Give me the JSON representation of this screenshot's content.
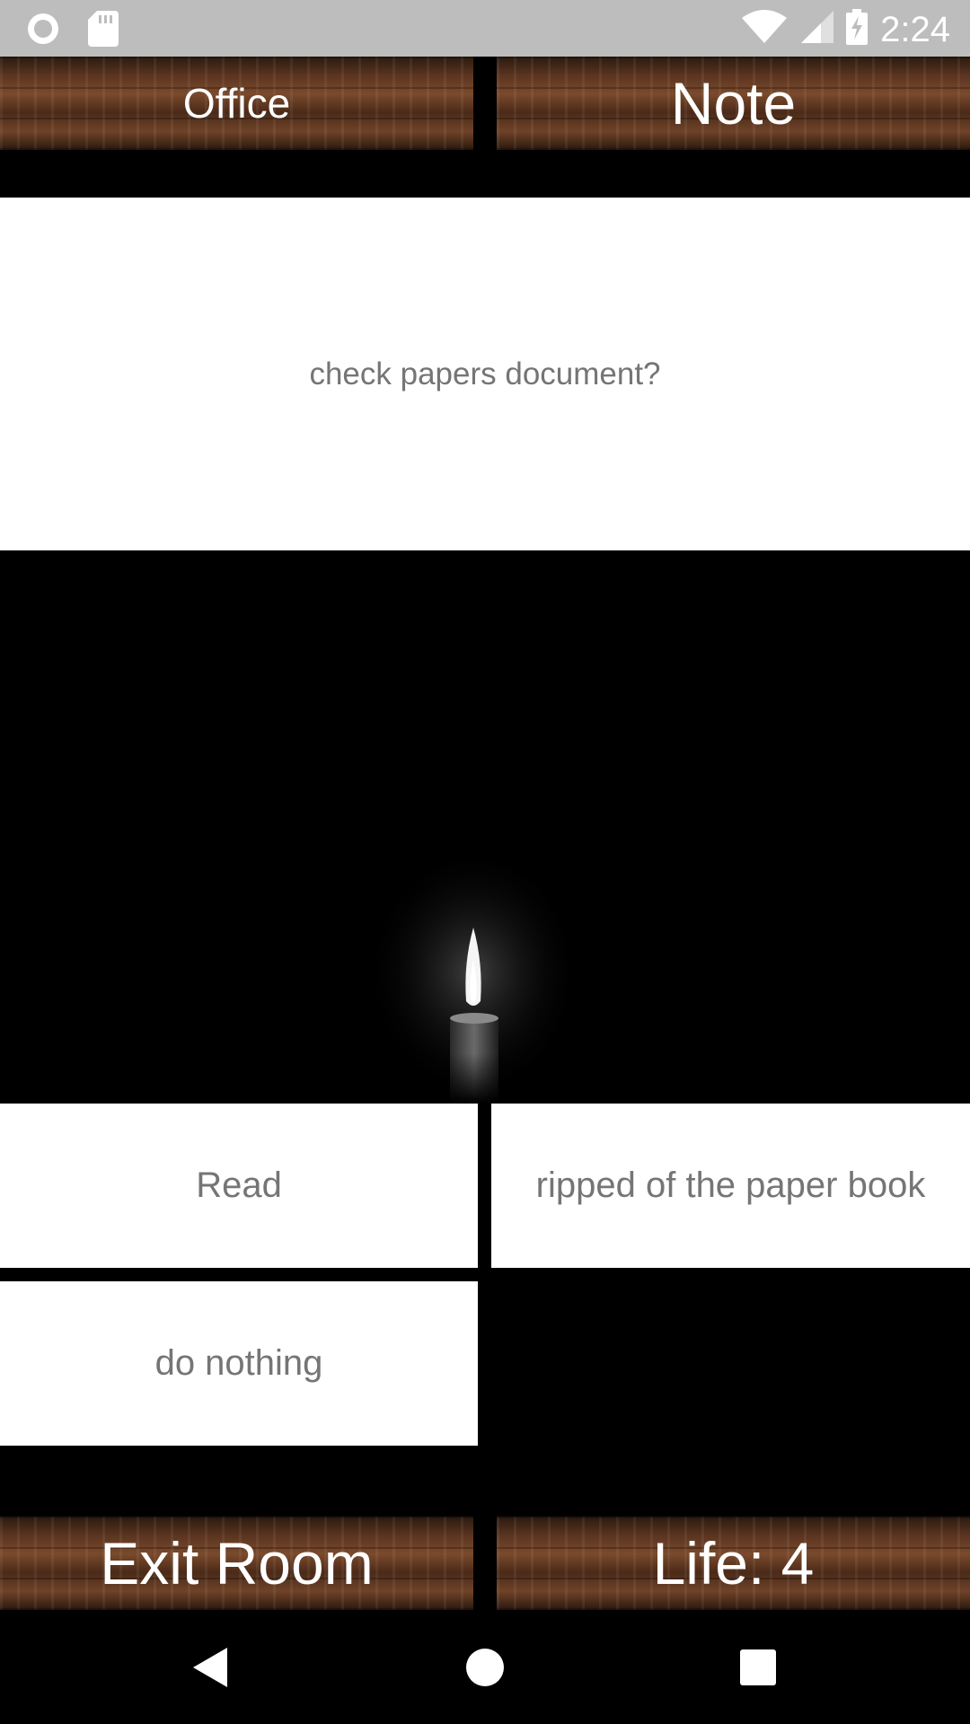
{
  "status_bar": {
    "time": "2:24",
    "icons": [
      "circle-record-icon",
      "sd-card-icon",
      "wifi-icon",
      "signal-icon",
      "battery-charging-icon"
    ]
  },
  "header": {
    "room_label": "Office",
    "note_label": "Note"
  },
  "question": {
    "text": "check papers document?"
  },
  "scene": {
    "image": "candle-icon"
  },
  "choices": [
    {
      "label": "Read"
    },
    {
      "label": "ripped of the paper book"
    },
    {
      "label": "do nothing"
    }
  ],
  "footer": {
    "exit_label": "Exit Room",
    "life_label": "Life: 4"
  },
  "nav_bar": {
    "icons": [
      "back-icon",
      "home-icon",
      "recents-icon"
    ]
  },
  "colors": {
    "status_bar_bg": "#bdbdbd",
    "text_gray": "#757575",
    "wood_dark": "#4a2a18"
  }
}
